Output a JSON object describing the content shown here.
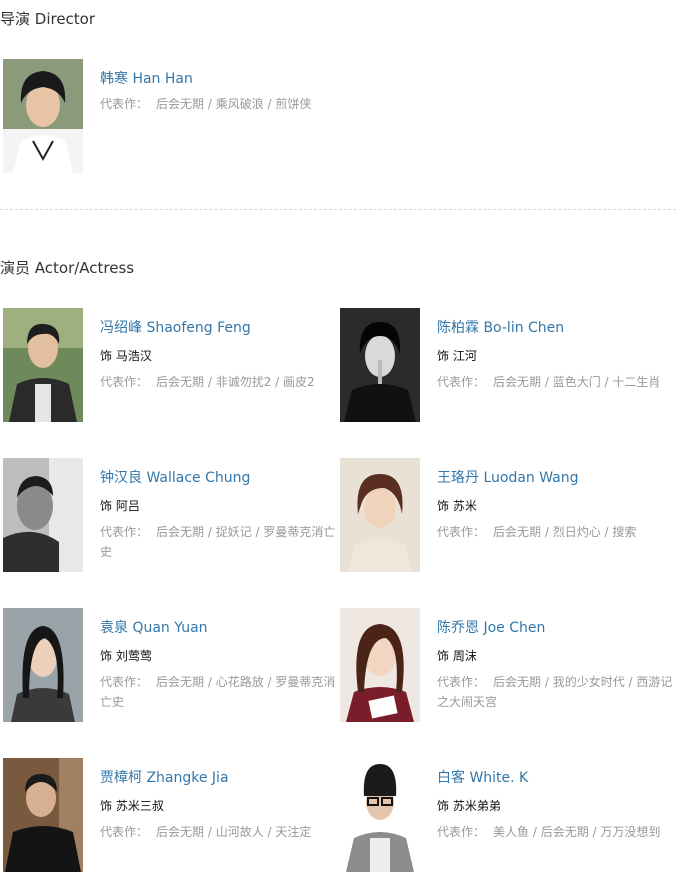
{
  "director_section": {
    "title": "导演 Director",
    "people": [
      {
        "name": "韩寒 Han Han",
        "works_label": "代表作：",
        "works": "后会无期 / 乘风破浪 / 煎饼侠"
      }
    ]
  },
  "actor_section": {
    "title": "演员 Actor/Actress",
    "people": [
      {
        "name": "冯绍峰 Shaofeng Feng",
        "role": "饰 马浩汉",
        "works_label": "代表作：",
        "works": "后会无期 / 非诚勿扰2 / 画皮2"
      },
      {
        "name": "陈柏霖 Bo-lin Chen",
        "role": "饰 江河",
        "works_label": "代表作：",
        "works": "后会无期 / 蓝色大门 / 十二生肖"
      },
      {
        "name": "钟汉良 Wallace Chung",
        "role": "饰 阿吕",
        "works_label": "代表作：",
        "works": "后会无期 / 捉妖记 / 罗曼蒂克消亡史"
      },
      {
        "name": "王珞丹 Luodan Wang",
        "role": "饰 苏米",
        "works_label": "代表作：",
        "works": "后会无期 / 烈日灼心 / 搜索"
      },
      {
        "name": "袁泉 Quan Yuan",
        "role": "饰 刘莺莺",
        "works_label": "代表作：",
        "works": "后会无期 / 心花路放 / 罗曼蒂克消亡史"
      },
      {
        "name": "陈乔恩 Joe Chen",
        "role": "饰 周沫",
        "works_label": "代表作：",
        "works": "后会无期 / 我的少女时代 / 西游记之大闹天宫"
      },
      {
        "name": "贾樟柯 Zhangke Jia",
        "role": "饰 苏米三叔",
        "works_label": "代表作：",
        "works": "后会无期 / 山河故人 / 天注定"
      },
      {
        "name": "白客 White. K",
        "role": "饰 苏米弟弟",
        "works_label": "代表作：",
        "works": "美人鱼 / 后会无期 / 万万没想到"
      }
    ]
  }
}
